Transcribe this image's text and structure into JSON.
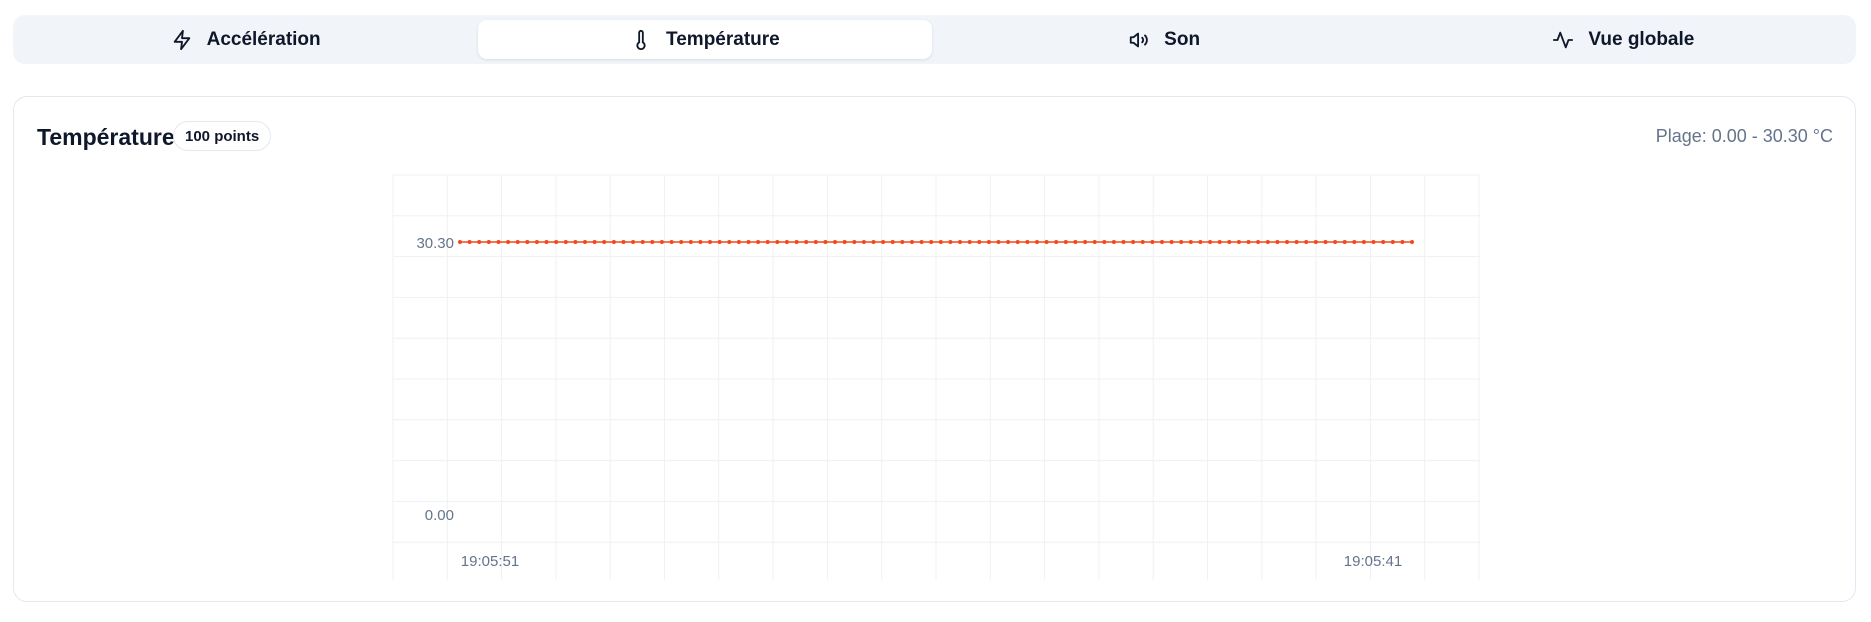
{
  "tabs": [
    {
      "label": "Accélération",
      "icon": "lightning-icon",
      "active": false
    },
    {
      "label": "Température",
      "icon": "thermometer-icon",
      "active": true
    },
    {
      "label": "Son",
      "icon": "speaker-icon",
      "active": false
    },
    {
      "label": "Vue globale",
      "icon": "activity-icon",
      "active": false
    }
  ],
  "panel": {
    "title": "Température",
    "badge": "100 points",
    "range": "Plage: 0.00 - 30.30 °C"
  },
  "chart_data": {
    "type": "line",
    "title": "",
    "xlabel": "",
    "ylabel": "",
    "ylim": [
      0,
      30.3
    ],
    "yticks": [
      "30.30",
      "0.00"
    ],
    "xticks": [
      "19:05:51",
      "19:05:41"
    ],
    "grid": true,
    "point_count": 100,
    "series": [
      {
        "color": "#f04a1c",
        "value_constant": 30.3
      }
    ]
  }
}
